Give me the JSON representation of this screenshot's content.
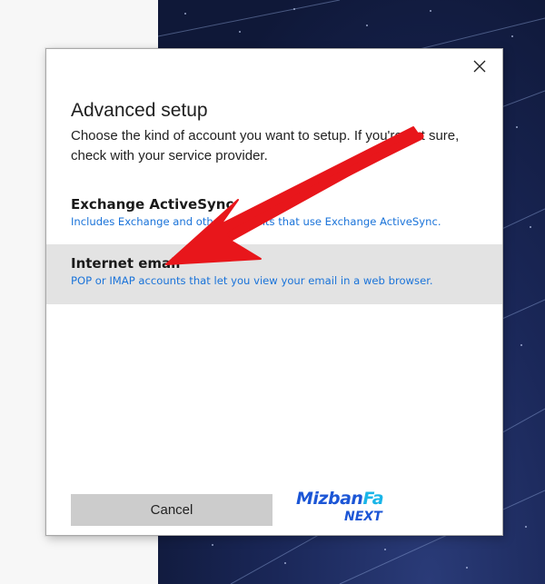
{
  "dialog": {
    "title": "Advanced setup",
    "description": "Choose the kind of account you want to setup. If you're not sure, check with your service provider.",
    "options": [
      {
        "title": "Exchange ActiveSync",
        "subtitle": "Includes Exchange and other accounts that use Exchange ActiveSync."
      },
      {
        "title": "Internet email",
        "subtitle": "POP or IMAP accounts that let you view your email in a web browser."
      }
    ],
    "cancel_label": "Cancel",
    "close_icon": "close-icon"
  },
  "watermark": {
    "brand_main": "Mizban",
    "brand_accent": "Fa",
    "brand_sub": "NEXT"
  },
  "colors": {
    "link_blue": "#1a73d9",
    "selected_bg": "#e3e3e3",
    "button_bg": "#cccccc",
    "arrow_red": "#e8161b"
  }
}
